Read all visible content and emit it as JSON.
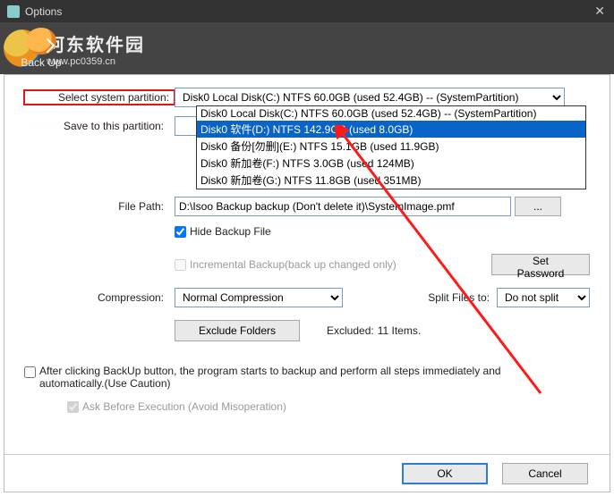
{
  "titlebar": {
    "title": "Options"
  },
  "toolbar": {
    "backup_label": "Back Up",
    "watermark_cn": "河东软件园",
    "watermark_url": "www.pc0359.cn"
  },
  "form": {
    "select_partition_label": "Select system partition:",
    "select_partition_value": "Disk0  Local Disk(C:) NTFS 60.0GB (used 52.4GB) -- (SystemPartition)",
    "save_partition_label": "Save to this partition:",
    "save_options": [
      "Disk0  Local Disk(C:) NTFS 60.0GB (used 52.4GB) -- (SystemPartition)",
      "Disk0  软件(D:) NTFS 142.9GB (used 8.0GB)",
      "Disk0  备份[勿删](E:) NTFS 15.1GB (used 11.9GB)",
      "Disk0  新加卷(F:) NTFS 3.0GB (used 124MB)",
      "Disk0  新加卷(G:) NTFS 11.8GB (used 351MB)"
    ],
    "save_selected_index": 1,
    "file_path_label": "File Path:",
    "file_path_value": "D:\\Isoo Backup backup (Don't delete it)\\SystemImage.pmf",
    "browse_label": "...",
    "hide_backup_label": "Hide Backup File",
    "hide_backup_checked": true,
    "incremental_label": "Incremental Backup(back up changed only)",
    "incremental_checked": false,
    "set_password_label": "Set Password",
    "compression_label": "Compression:",
    "compression_value": "Normal Compression",
    "split_label": "Split Files to:",
    "split_value": "Do not split",
    "exclude_btn_label": "Exclude Folders",
    "excluded_label": "Excluded:",
    "excluded_count": "11 Items.",
    "auto_label": "After clicking BackUp button, the program starts to backup and perform all steps immediately and automatically.(Use Caution)",
    "auto_checked": false,
    "ask_label": "Ask Before Execution (Avoid Misoperation)",
    "ask_checked": true
  },
  "footer": {
    "ok": "OK",
    "cancel": "Cancel"
  }
}
